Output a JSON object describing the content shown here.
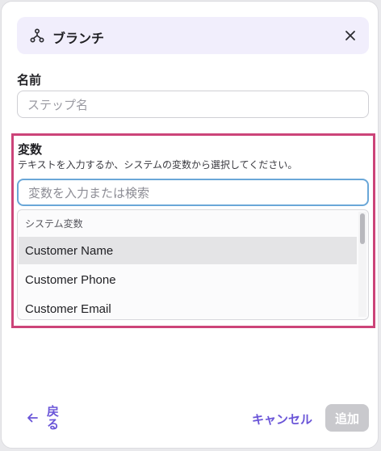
{
  "dialog": {
    "title": "ブランチ",
    "icon": "branch-icon",
    "close_icon": "close-icon"
  },
  "name_field": {
    "label": "名前",
    "placeholder": "ステップ名"
  },
  "variable_field": {
    "label": "変数",
    "hint": "テキストを入力するか、システムの変数から選択してください。",
    "placeholder": "変数を入力または検索"
  },
  "dropdown": {
    "group_label": "システム変数",
    "items": [
      {
        "label": "Customer Name",
        "highlighted": true
      },
      {
        "label": "Customer Phone",
        "highlighted": false
      },
      {
        "label": "Customer Email",
        "highlighted": false
      }
    ]
  },
  "footer": {
    "back_line1": "戻",
    "back_line2": "る",
    "cancel": "キャンセル",
    "add": "追加"
  },
  "colors": {
    "accent": "#6a55d8",
    "highlight_border": "#cc4479",
    "header_bg": "#f1eefc",
    "disabled_button": "#c9c9cd"
  }
}
